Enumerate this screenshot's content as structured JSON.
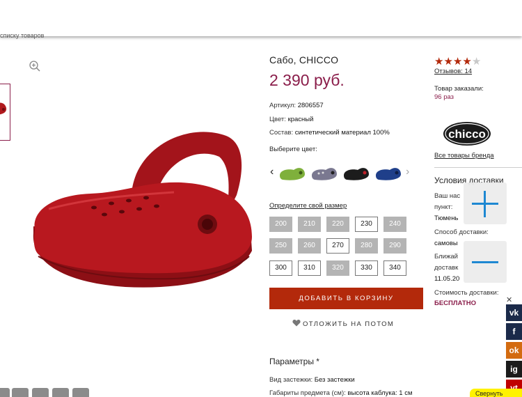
{
  "nav": {
    "back_label": "списку товаров"
  },
  "product": {
    "title": "Сабо, CHICCO",
    "price": "2 390 руб.",
    "article_label": "Артикул:",
    "article_value": "2806557",
    "color_label": "Цвет:",
    "color_value": "красный",
    "composition_label": "Состав:",
    "composition_value": "синтетический материал 100%",
    "choose_color": "Выберите цвет:",
    "color_options": [
      {
        "name": "green",
        "color": "#7fb03c"
      },
      {
        "name": "grey",
        "color": "#7a7890"
      },
      {
        "name": "black",
        "color": "#1c1c1c"
      },
      {
        "name": "navy",
        "color": "#1f3f8a"
      }
    ],
    "size_link": "Определите свой размер",
    "sizes": [
      {
        "label": "200",
        "available": false
      },
      {
        "label": "210",
        "available": false
      },
      {
        "label": "220",
        "available": false
      },
      {
        "label": "230",
        "available": true
      },
      {
        "label": "240",
        "available": false
      },
      {
        "label": "250",
        "available": false
      },
      {
        "label": "260",
        "available": false
      },
      {
        "label": "270",
        "available": true
      },
      {
        "label": "280",
        "available": false
      },
      {
        "label": "290",
        "available": false
      },
      {
        "label": "300",
        "available": true
      },
      {
        "label": "310",
        "available": true
      },
      {
        "label": "320",
        "available": false
      },
      {
        "label": "330",
        "available": true
      },
      {
        "label": "340",
        "available": true
      }
    ],
    "add_to_cart": "ДОБАВИТЬ В КОРЗИНУ",
    "save_later": "ОТЛОЖИТЬ НА ПОТОМ",
    "params_title": "Параметры *",
    "fastener_label": "Вид застежки:",
    "fastener_value": "Без застежки",
    "dims_label": "Габариты предмета (см):",
    "dims_value": "высота каблука: 1 см"
  },
  "sidebar": {
    "rating": 4,
    "rating_max": 5,
    "reviews": "Отзывов: 14",
    "ordered_label": "Товар заказали:",
    "ordered_count": "96 раз",
    "brand_logo_text": "chicco",
    "brand_link": "Все товары бренда",
    "delivery_title": "Условия доставки",
    "delivery_point_label_1": "Ваш нас",
    "delivery_point_label_2": "пункт:",
    "delivery_city": "Тюмень",
    "delivery_method_label": "Способ доставки:",
    "delivery_method_value": "самовы",
    "nearest_label_1": "Ближай",
    "nearest_label_2": "доставк",
    "nearest_date": "11.05.20",
    "cost_label": "Стоимость доставки:",
    "cost_value": "БЕСПЛАТНО"
  },
  "zoom_controls": {
    "plus": "+",
    "minus": "−"
  },
  "social": {
    "items": [
      {
        "name": "vk",
        "glyph": "vk",
        "color": "#1b2a4a"
      },
      {
        "name": "facebook",
        "glyph": "f",
        "color": "#1b2a4a"
      },
      {
        "name": "odnoklassniki",
        "glyph": "ok",
        "color": "#d36b10"
      },
      {
        "name": "instagram",
        "glyph": "ig",
        "color": "#1b1b1b"
      },
      {
        "name": "youtube",
        "glyph": "yt",
        "color": "#c00000"
      }
    ],
    "collapse_label": "Свернуть"
  },
  "colors": {
    "accent": "#8a1d4a",
    "cart_button": "#b3290b",
    "zoom_blue": "#1e88d2"
  }
}
